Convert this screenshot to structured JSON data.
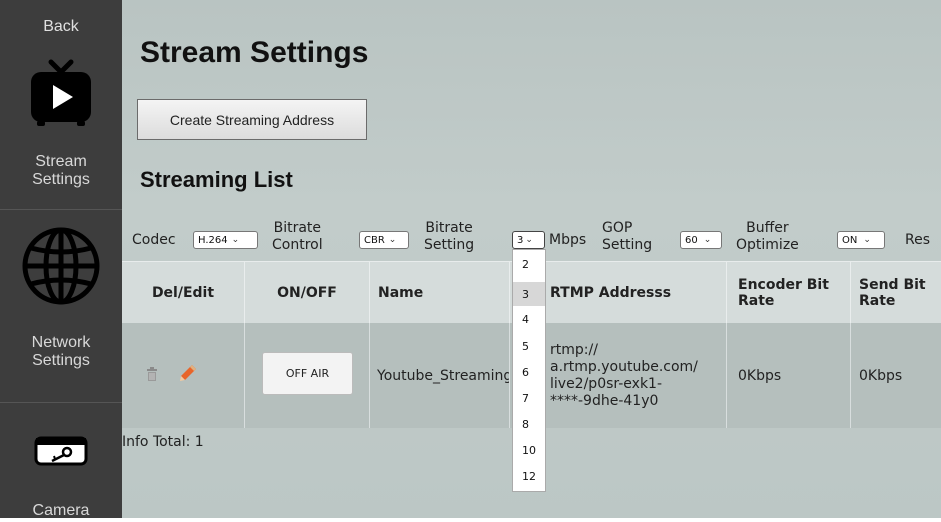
{
  "sidebar": {
    "back_label": "Back",
    "items": [
      {
        "label_line1": "Stream",
        "label_line2": "Settings",
        "icon": "tv-play-icon"
      },
      {
        "label_line1": "Network",
        "label_line2": "Settings",
        "icon": "globe-icon"
      },
      {
        "label_line1": "Camera",
        "label_line2": "",
        "icon": "key-icon"
      }
    ]
  },
  "page": {
    "title": "Stream Settings",
    "create_button": "Create Streaming Address",
    "list_title": "Streaming List"
  },
  "filters": {
    "codec_label": "Codec",
    "codec_value": "H.264",
    "bitrate_control_line1": "Bitrate",
    "bitrate_control_line2": "Control",
    "bitrate_control_value": "CBR",
    "bitrate_setting_line1": "Bitrate",
    "bitrate_setting_line2": "Setting",
    "bitrate_setting_value": "3",
    "mbps_label": "Mbps",
    "gop_line1": "GOP",
    "gop_line2": "Setting",
    "gop_value": "60",
    "buffer_line1": "Buffer",
    "buffer_line2": "Optimize",
    "buffer_value": "ON",
    "res_label": "Res"
  },
  "table": {
    "headers": {
      "del_edit": "Del/Edit",
      "on_off": "ON/OFF",
      "name": "Name",
      "rtmp": "RTMP Addresss",
      "encoder_line1": "Encoder Bit",
      "encoder_line2": "Rate",
      "send_line1": "Send Bit",
      "send_line2": "Rate"
    },
    "rows": [
      {
        "on_off": "OFF AIR",
        "name": "Youtube_Streaming",
        "rtmp_line1": "rtmp://",
        "rtmp_line2": "a.rtmp.youtube.com/",
        "rtmp_line3": "live2/p0sr-exk1-",
        "rtmp_line4": "****-9dhe-41y0",
        "encoder_rate": "0Kbps",
        "send_rate": "0Kbps"
      }
    ],
    "info_total": "Info Total: 1"
  },
  "bitrate_dropdown": {
    "options": [
      "2",
      "3",
      "4",
      "5",
      "6",
      "7",
      "8",
      "10",
      "12"
    ],
    "selected": "3"
  },
  "colors": {
    "sidebar_bg": "#3d3d3d",
    "main_bg": "#bcc7c5",
    "pencil": "#e8652a"
  }
}
